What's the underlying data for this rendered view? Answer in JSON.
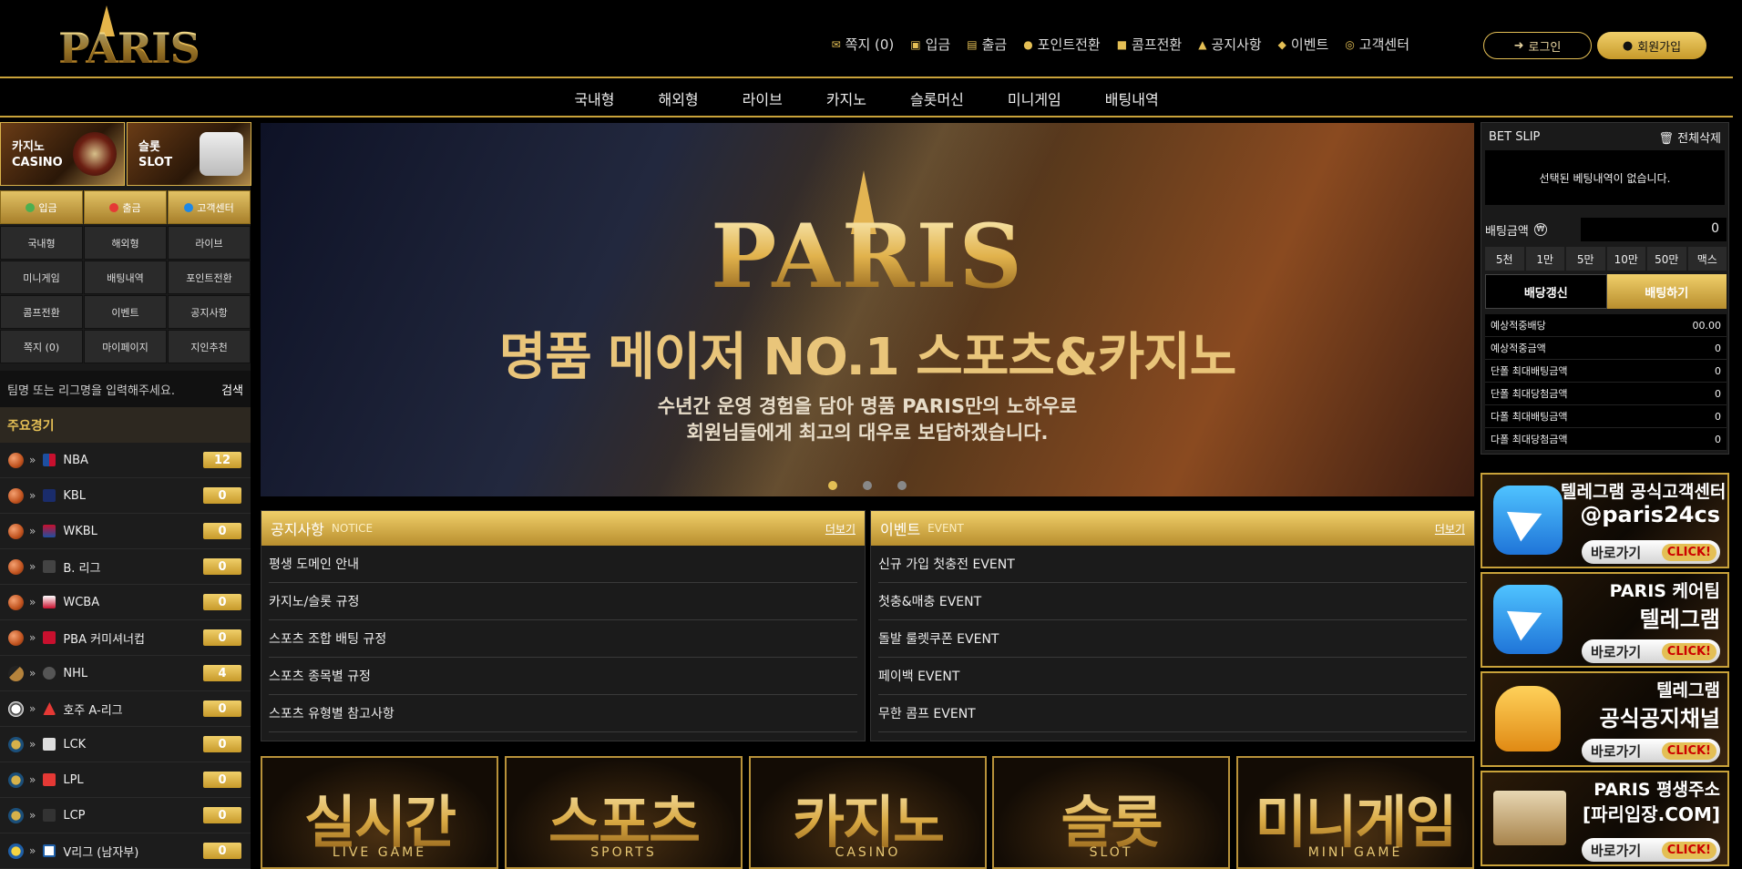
{
  "brand": {
    "logo_text": "PARIS"
  },
  "header": {
    "nav": [
      {
        "icon": "envelope-icon",
        "label": "쪽지 (0)"
      },
      {
        "icon": "deposit-icon",
        "label": "입금"
      },
      {
        "icon": "withdraw-icon",
        "label": "출금"
      },
      {
        "icon": "point-icon",
        "label": "포인트전환"
      },
      {
        "icon": "comp-icon",
        "label": "콤프전환"
      },
      {
        "icon": "bell-icon",
        "label": "공지사항"
      },
      {
        "icon": "gift-icon",
        "label": "이벤트"
      },
      {
        "icon": "headset-icon",
        "label": "고객센터"
      }
    ],
    "login": "로그인",
    "join": "회원가입"
  },
  "mainnav": [
    "국내형",
    "해외형",
    "라이브",
    "카지노",
    "슬롯머신",
    "미니게임",
    "배팅내역"
  ],
  "sidebar": {
    "promos": [
      {
        "ko": "카지노",
        "en": "CASINO"
      },
      {
        "ko": "슬롯",
        "en": "SLOT"
      }
    ],
    "gold_buttons": [
      "입금",
      "출금",
      "고객센터"
    ],
    "menu": [
      "국내형",
      "해외형",
      "라이브",
      "미니게임",
      "배팅내역",
      "포인트전환",
      "콤프전환",
      "이벤트",
      "공지사항",
      "쪽지 (0)",
      "마이페이지",
      "지인추천"
    ],
    "search_placeholder": "팀명 또는 리그명을 입력해주세요.",
    "search_button": "검색",
    "featured_title": "주요경기",
    "leagues": [
      {
        "name": "NBA",
        "count": "12",
        "sport": "basketball"
      },
      {
        "name": "KBL",
        "count": "0",
        "sport": "basketball"
      },
      {
        "name": "WKBL",
        "count": "0",
        "sport": "basketball"
      },
      {
        "name": "B. 리그",
        "count": "0",
        "sport": "basketball"
      },
      {
        "name": "WCBA",
        "count": "0",
        "sport": "basketball"
      },
      {
        "name": "PBA 커미셔너컵",
        "count": "0",
        "sport": "basketball"
      },
      {
        "name": "NHL",
        "count": "4",
        "sport": "hockey"
      },
      {
        "name": "호주 A-리그",
        "count": "0",
        "sport": "soccer"
      },
      {
        "name": "LCK",
        "count": "0",
        "sport": "esports"
      },
      {
        "name": "LPL",
        "count": "0",
        "sport": "esports"
      },
      {
        "name": "LCP",
        "count": "0",
        "sport": "esports"
      },
      {
        "name": "V리그 (남자부)",
        "count": "0",
        "sport": "volleyball"
      }
    ]
  },
  "banner": {
    "logo": "PARIS",
    "headline": "명품 메이저 NO.1 스포츠&카지노",
    "sub1": "수년간 운영 경험을 담아 명품 PARIS만의 노하우로",
    "sub2": "회원님들에게 최고의 대우로 보답하겠습니다."
  },
  "notice": {
    "title": "공지사항",
    "en": "NOTICE",
    "more": "더보기",
    "items": [
      "평생 도메인 안내",
      "카지노/슬롯 규정",
      "스포츠 조합 배팅 규정",
      "스포츠 종목별 규정",
      "스포츠 유형별 참고사항"
    ]
  },
  "event": {
    "title": "이벤트",
    "en": "EVENT",
    "more": "더보기",
    "items": [
      "신규 가입 첫충전 EVENT",
      "첫충&매충 EVENT",
      "돌발 룰렛쿠폰 EVENT",
      "페이백 EVENT",
      "무한 콤프 EVENT"
    ]
  },
  "categories": [
    {
      "ko": "실시간",
      "en": "LIVE GAME"
    },
    {
      "ko": "스포츠",
      "en": "SPORTS"
    },
    {
      "ko": "카지노",
      "en": "CASINO"
    },
    {
      "ko": "슬롯",
      "en": "SLOT"
    },
    {
      "ko": "미니게임",
      "en": "MINI GAME"
    }
  ],
  "betslip": {
    "title": "BET SLIP",
    "clear": "전체삭제",
    "empty": "선택된 베팅내역이 없습니다.",
    "amount_label": "배팅금액",
    "currency": "₩",
    "amount_value": "0",
    "quick": [
      "5천",
      "1만",
      "5만",
      "10만",
      "50만",
      "맥스"
    ],
    "refresh": "배당갱신",
    "place": "배팅하기",
    "stats": [
      {
        "label": "예상적중배당",
        "value": "00.00"
      },
      {
        "label": "예상적중금액",
        "value": "0"
      },
      {
        "label": "단폴 최대배팅금액",
        "value": "0"
      },
      {
        "label": "단폴 최대당첨금액",
        "value": "0"
      },
      {
        "label": "다폴 최대배팅금액",
        "value": "0"
      },
      {
        "label": "다폴 최대당첨금액",
        "value": "0"
      }
    ]
  },
  "ads": [
    {
      "line1": "텔레그램 공식고객센터",
      "line2": "@paris24cs",
      "go": "바로가기",
      "click": "CLICK!"
    },
    {
      "line1": "PARIS 케어팀",
      "line2": "텔레그램",
      "go": "바로가기",
      "click": "CLICK!"
    },
    {
      "line1": "텔레그램",
      "line2": "공식공지채널",
      "go": "바로가기",
      "click": "CLICK!"
    },
    {
      "line1": "PARIS 평생주소",
      "line2": "[파리입장.COM]",
      "go": "바로가기",
      "click": "CLICK!"
    }
  ]
}
